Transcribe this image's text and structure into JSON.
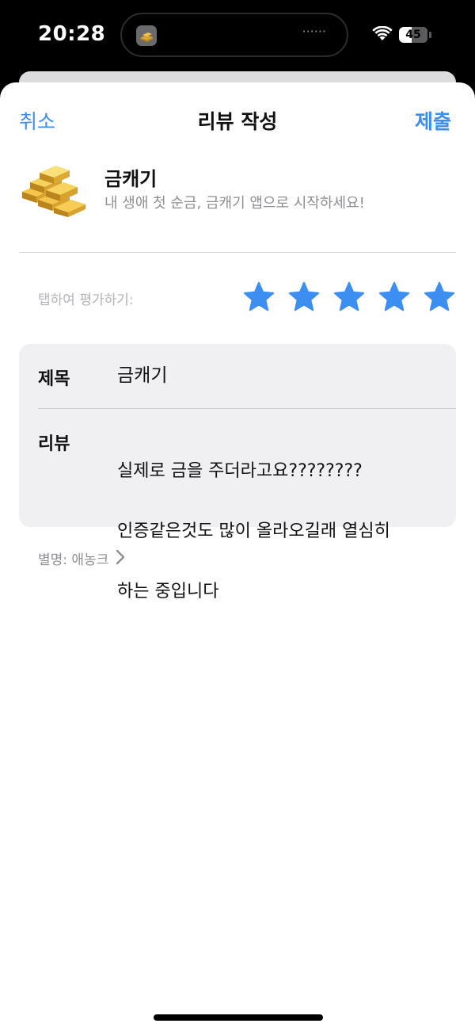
{
  "status_bar": {
    "time": "20:28",
    "island_dots": "······",
    "battery_percent": "45",
    "battery_level": 0.45
  },
  "nav": {
    "cancel_label": "취소",
    "title": "리뷰 작성",
    "submit_label": "제출"
  },
  "app": {
    "name": "금캐기",
    "tagline": "내 생애 첫 순금, 금캐기 앱으로 시작하세요!",
    "icon": "gold-bars-icon"
  },
  "rating": {
    "prompt": "탭하여 평가하기:",
    "stars_total": 5,
    "stars_selected": 5,
    "star_color": "#3c8ef0"
  },
  "form": {
    "title_label": "제목",
    "title_value": "금캐기",
    "review_label": "리뷰",
    "review_lines": [
      "실제로 금을 주더라고요????????",
      "인증같은것도 많이 올라오길래 열심히",
      "하는 중입니다"
    ]
  },
  "nickname": {
    "label": "별명: 애농크"
  },
  "colors": {
    "accent": "#3c8ef0",
    "secondary_text": "#8e8e93",
    "card_bg": "#f0f0f2"
  }
}
